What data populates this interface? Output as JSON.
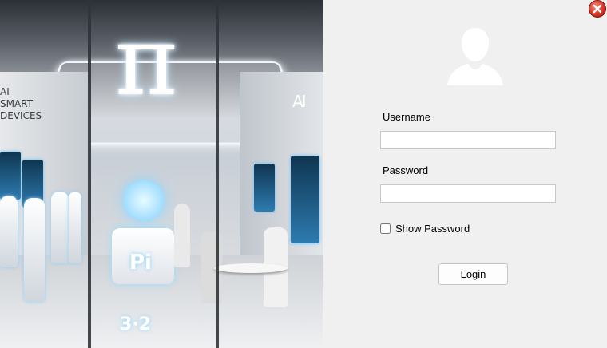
{
  "hero": {
    "pi_symbol": "π",
    "sign_text": "Pi",
    "floor_text": "3·2",
    "wall_text_left": "AI\nSMART\nDEVICES",
    "wall_text_right": "AI"
  },
  "form": {
    "username_label": "Username",
    "username_value": "",
    "password_label": "Password",
    "password_value": "",
    "show_password_label": "Show Password",
    "show_password_checked": false,
    "login_label": "Login"
  },
  "icons": {
    "close": "close-icon",
    "avatar": "user-avatar-icon"
  },
  "colors": {
    "panel_background": "#f0f0f0",
    "close_button": "#d2301f"
  }
}
